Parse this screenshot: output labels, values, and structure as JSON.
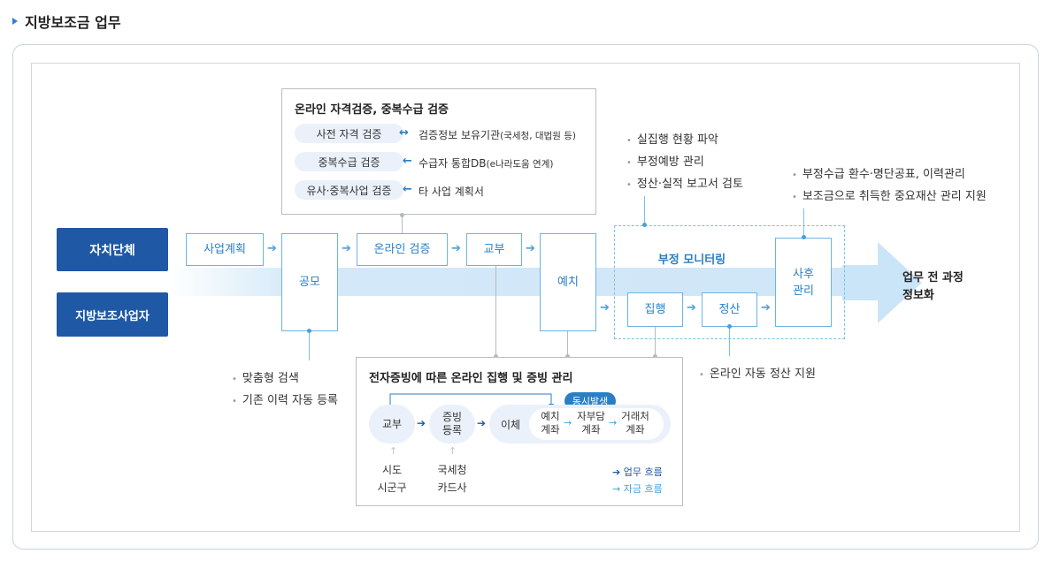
{
  "title": "지방보조금 업무",
  "actors": {
    "local_gov": "자치단체",
    "operator": "지방보조사업자"
  },
  "steps": {
    "plan": "사업계획",
    "notice": "공모",
    "online_verify": "온라인 검증",
    "grant": "교부",
    "deposit": "예치",
    "monitoring": "부정 모니터링",
    "execution": "집행",
    "settlement": "정산",
    "post_mgmt_l1": "사후",
    "post_mgmt_l2": "관리",
    "final_l1": "업무 전 과정",
    "final_l2": "정보화"
  },
  "verify_panel": {
    "title": "온라인 자격검증, 중복수급 검증",
    "rows": [
      {
        "label": "사전 자격 검증",
        "arrow": "↔",
        "source": "검증정보 보유기관",
        "note": "(국세청, 대법원 등)"
      },
      {
        "label": "중복수급 검증",
        "arrow": "←",
        "source": "수급자 통합DB",
        "note": "(e나라도움 연계)"
      },
      {
        "label": "유사·중복사업 검증",
        "arrow": "←",
        "source": "타 사업 계획서",
        "note": ""
      }
    ]
  },
  "monitor_bullets": [
    "실집행 현황 파악",
    "부정예방 관리",
    "정산·실적 보고서 검토"
  ],
  "post_bullets": [
    "부정수급 환수·명단공표, 이력관리",
    "보조금으로 취득한 중요재산 관리 지원"
  ],
  "notice_bullets": [
    "맞춤형 검색",
    "기존 이력 자동 등록"
  ],
  "settle_bullets": [
    "온라인 자동 정산 지원"
  ],
  "evidence_panel": {
    "title": "전자증빙에 따른 온라인 집행 및 증빙 관리",
    "badge": "동시발생",
    "grant": "교부",
    "reg_l1": "증빙",
    "reg_l2": "등록",
    "transfer": "이체",
    "acc1_l1": "예치",
    "acc1_l2": "계좌",
    "acc2_l1": "자부담",
    "acc2_l2": "계좌",
    "acc3_l1": "거래처",
    "acc3_l2": "계좌",
    "src1_l1": "시도",
    "src1_l2": "시군구",
    "src2_l1": "국세청",
    "src2_l2": "카드사",
    "legend_work": "업무 흐름",
    "legend_fund": "자금 흐름"
  },
  "colors": {
    "navy": "#1f58a4",
    "accent": "#2a7fc4",
    "arrow": "#4aa0d8",
    "band": "#d4e9f8"
  }
}
